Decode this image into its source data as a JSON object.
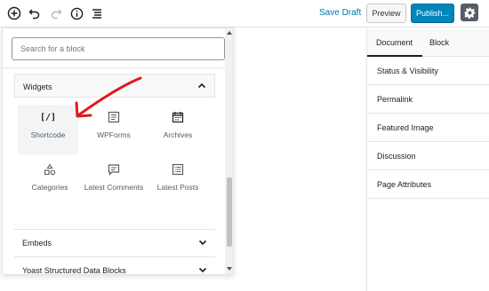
{
  "toolbar": {
    "add_icon": "plus-circle-icon",
    "undo_icon": "undo-icon",
    "redo_icon": "redo-icon",
    "info_icon": "info-icon",
    "outline_icon": "list-view-icon",
    "save_draft": "Save Draft",
    "preview": "Preview",
    "publish": "Publish...",
    "settings_icon": "gear-icon"
  },
  "sidebar": {
    "tabs": [
      "Document",
      "Block"
    ],
    "active_tab": "Document",
    "panels": [
      "Status & Visibility",
      "Permalink",
      "Featured Image",
      "Discussion",
      "Page Attributes"
    ]
  },
  "inserter": {
    "search_placeholder": "Search for a block",
    "widgets_title": "Widgets",
    "blocks": [
      {
        "label": "Shortcode",
        "icon": "shortcode-icon"
      },
      {
        "label": "WPForms",
        "icon": "wpforms-icon"
      },
      {
        "label": "Archives",
        "icon": "calendar-icon"
      },
      {
        "label": "Categories",
        "icon": "categories-icon"
      },
      {
        "label": "Latest Comments",
        "icon": "comment-icon"
      },
      {
        "label": "Latest Posts",
        "icon": "list-icon"
      }
    ],
    "shortcode_glyph": "[/]",
    "collapsed_panels": [
      "Embeds",
      "Yoast Structured Data Blocks"
    ]
  },
  "colors": {
    "accent": "#0085ba",
    "link": "#0073aa",
    "annotation": "#e0181f"
  }
}
